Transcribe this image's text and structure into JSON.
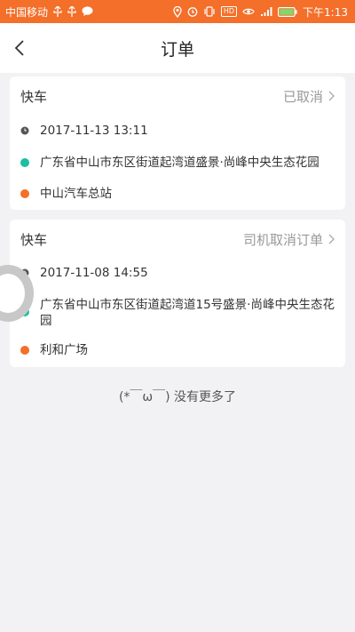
{
  "status_bar": {
    "carrier": "中国移动",
    "time": "下午1:13",
    "hd_label": "HD"
  },
  "nav": {
    "title": "订单"
  },
  "orders": [
    {
      "type": "快车",
      "status": "已取消",
      "datetime": "2017-11-13 13:11",
      "start": "广东省中山市东区街道起湾道盛景·尚峰中央生态花园",
      "end": "中山汽车总站"
    },
    {
      "type": "快车",
      "status": "司机取消订单",
      "datetime": "2017-11-08 14:55",
      "start": "广东省中山市东区街道起湾道15号盛景·尚峰中央生态花园",
      "end": "利和广场"
    }
  ],
  "footer": {
    "text": "(*￣ω￣) 没有更多了"
  },
  "colors": {
    "status_bar": "#f36f2a",
    "start_dot": "#1bbfa1",
    "end_dot": "#f36f2a"
  }
}
